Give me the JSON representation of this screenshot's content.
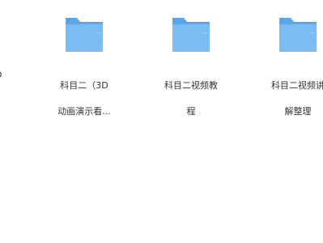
{
  "files": {
    "partial_item_label": "D",
    "items": [
      {
        "label_line1": "科目二（3D",
        "label_line2": "动画演示看...",
        "icon": "folder-icon"
      },
      {
        "label_line1": "科目二视频教",
        "label_line2": "程",
        "icon": "folder-icon"
      },
      {
        "label_line1": "科目二视频讲",
        "label_line2": "解整理",
        "icon": "folder-icon"
      }
    ]
  },
  "colors": {
    "folder_back": "#5aa6e8",
    "folder_front": "#7bbdf2",
    "text": "#333333"
  }
}
